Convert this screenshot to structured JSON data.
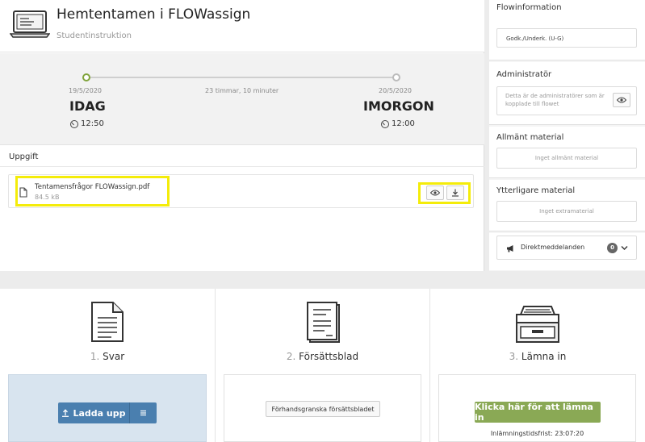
{
  "header": {
    "title": "Hemtentamen i FLOWassign",
    "subtitle": "Studentinstruktion"
  },
  "timeline": {
    "start_date": "19/5/2020",
    "start_label": "IDAG",
    "start_time": "12:50",
    "duration": "23 timmar, 10 minuter",
    "end_date": "20/5/2020",
    "end_label": "IMORGON",
    "end_time": "12:00"
  },
  "task": {
    "section_label": "Uppgift",
    "file_name": "Tentamensfrågor FLOWassign.pdf",
    "file_size": "84.5 kB"
  },
  "sidebar": {
    "flow_title": "Flowinformation",
    "flow_value": "Godk./Underk. (U-G)",
    "admin_title": "Administratör",
    "admin_text": "Detta är de administratörer som är kopplade till flowet",
    "general_title": "Allmänt material",
    "general_value": "Inget allmänt material",
    "extra_title": "Ytterligare material",
    "extra_value": "Inget extramaterial",
    "messages_label": "Direktmeddelanden",
    "messages_count": "0"
  },
  "steps": [
    {
      "num": "1.",
      "label": "Svar",
      "button": "Ladda upp"
    },
    {
      "num": "2.",
      "label": "Försättsblad",
      "button": "Förhandsgranska försättsbladet"
    },
    {
      "num": "3.",
      "label": "Lämna in",
      "button": "Klicka här för att lämna in",
      "deadline": "Inlämningstidsfrist: 23:07:20"
    }
  ],
  "colors": {
    "highlight": "#f4ec0a",
    "primary": "#4a7faf",
    "submit": "#8aa955",
    "timeline_active": "#7fa33a"
  }
}
